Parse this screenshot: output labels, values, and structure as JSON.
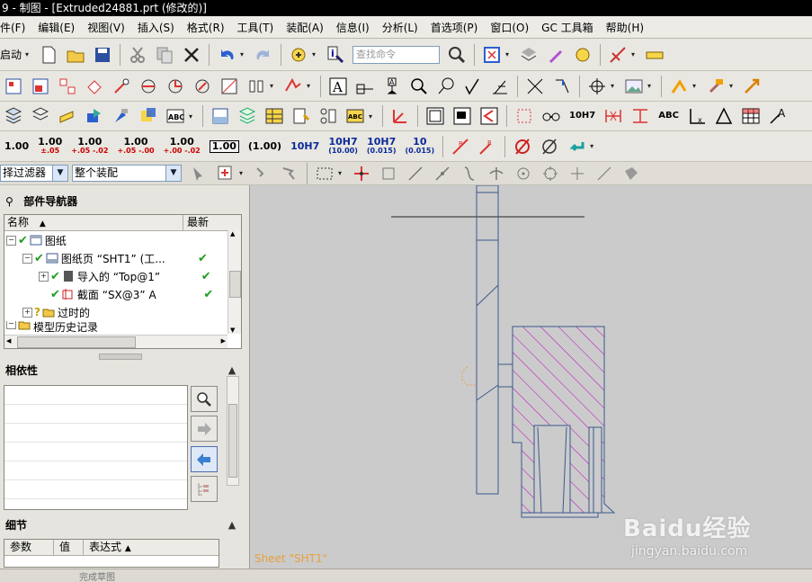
{
  "window": {
    "title": "9 - 制图 - [Extruded24881.prt (修改的)]"
  },
  "menu": [
    "件(F)",
    "编辑(E)",
    "视图(V)",
    "插入(S)",
    "格式(R)",
    "工具(T)",
    "装配(A)",
    "信息(I)",
    "分析(L)",
    "首选项(P)",
    "窗口(O)",
    "GC 工具箱",
    "帮助(H)"
  ],
  "toolbar1": {
    "start_label": "启动",
    "search_placeholder": "查找命令"
  },
  "toolbar4": {
    "tolerances": [
      {
        "top": "1.00",
        "bottom": ""
      },
      {
        "top": "1.00",
        "bottom": "±.05"
      },
      {
        "top": "1.00",
        "bottom": "+.05 -.02"
      },
      {
        "top": "1.00",
        "bottom": "+.05 -.00"
      },
      {
        "top": "1.00",
        "bottom": "+.00 -.02"
      }
    ],
    "boxed": "1.00",
    "paren": "(1.00)",
    "fit1": "10H7",
    "fit2": "10H7",
    "fit2_sub": "(10.00)",
    "fit3": "10H7",
    "fit3_sub": "(0.015)",
    "fit4": "10",
    "fit4_sub": "(0.015)"
  },
  "toolbar3": {
    "fit_label": "10H7",
    "abc_label": "ABC"
  },
  "selection_bar": {
    "filter_label": "择过滤器",
    "scope_label": "整个装配"
  },
  "part_navigator": {
    "title": "部件导航器",
    "col_name": "名称",
    "col_latest": "最新",
    "rows": [
      {
        "label": "图纸"
      },
      {
        "label": "图纸页 “SHT1” (工..."
      },
      {
        "label": "导入的 “Top@1”"
      },
      {
        "label": "截面 “SX@3” A"
      },
      {
        "label": "过时的"
      },
      {
        "label": "模型历史记录"
      }
    ]
  },
  "dependencies": {
    "title": "相依性"
  },
  "details": {
    "title": "细节",
    "col_param": "参数",
    "col_value": "值",
    "col_expr": "表达式"
  },
  "canvas": {
    "sheet_label": "Sheet \"SHT1\""
  },
  "watermark": {
    "brand": "Baidu经验",
    "url": "jingyan.baidu.com"
  },
  "statusbar": {
    "text": "完成草图"
  },
  "colors": {
    "hatch": "#c000c0",
    "geometry": "#3a5a8c",
    "sheet_label": "#e8a03c"
  }
}
